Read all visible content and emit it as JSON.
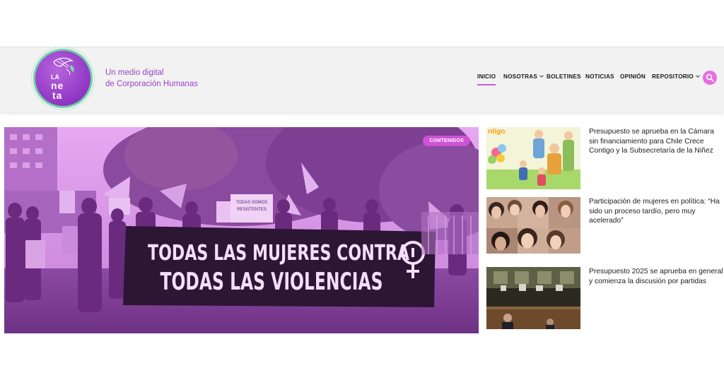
{
  "brand": {
    "logo_text": "LA NETA",
    "tagline_line1": "Un medio digital",
    "tagline_line2": "de Corporación Humanas",
    "accent_color": "#9a44c8",
    "logo_ring_color": "#6fd0a8"
  },
  "nav": {
    "items": [
      {
        "label": "INICIO",
        "active": true,
        "dropdown": false
      },
      {
        "label": "NOSOTRAS",
        "active": false,
        "dropdown": true
      },
      {
        "label": "BOLETINES",
        "active": false,
        "dropdown": false
      },
      {
        "label": "NOTICIAS",
        "active": false,
        "dropdown": false
      },
      {
        "label": "OPINIÓN",
        "active": false,
        "dropdown": false
      },
      {
        "label": "REPOSITORIO",
        "active": false,
        "dropdown": true
      }
    ],
    "search_icon": "search-icon",
    "search_color": "#e76fe0"
  },
  "hero": {
    "badge": "CONTENIDOS",
    "banner_line1": "TODAS LAS MUJERES CONTRA",
    "banner_line2": "TODAS LAS VIOLENCIAS",
    "small_sign_line1": "TODAS SOMOS",
    "small_sign_line2": "RESISTENTES",
    "thumb_overlay_text": "ntigo"
  },
  "side_articles": [
    {
      "title": "Presupuesto se aprueba en la Cámara sin financiamiento para Chile Crece Contigo y la Subsecretaría de la Niñez"
    },
    {
      "title": "Participación de mujeres en política: “Ha sido un proceso tardío, pero muy acelerado”"
    },
    {
      "title": "Presupuesto 2025 se aprueba en general y comienza la discusión por partidas"
    }
  ]
}
